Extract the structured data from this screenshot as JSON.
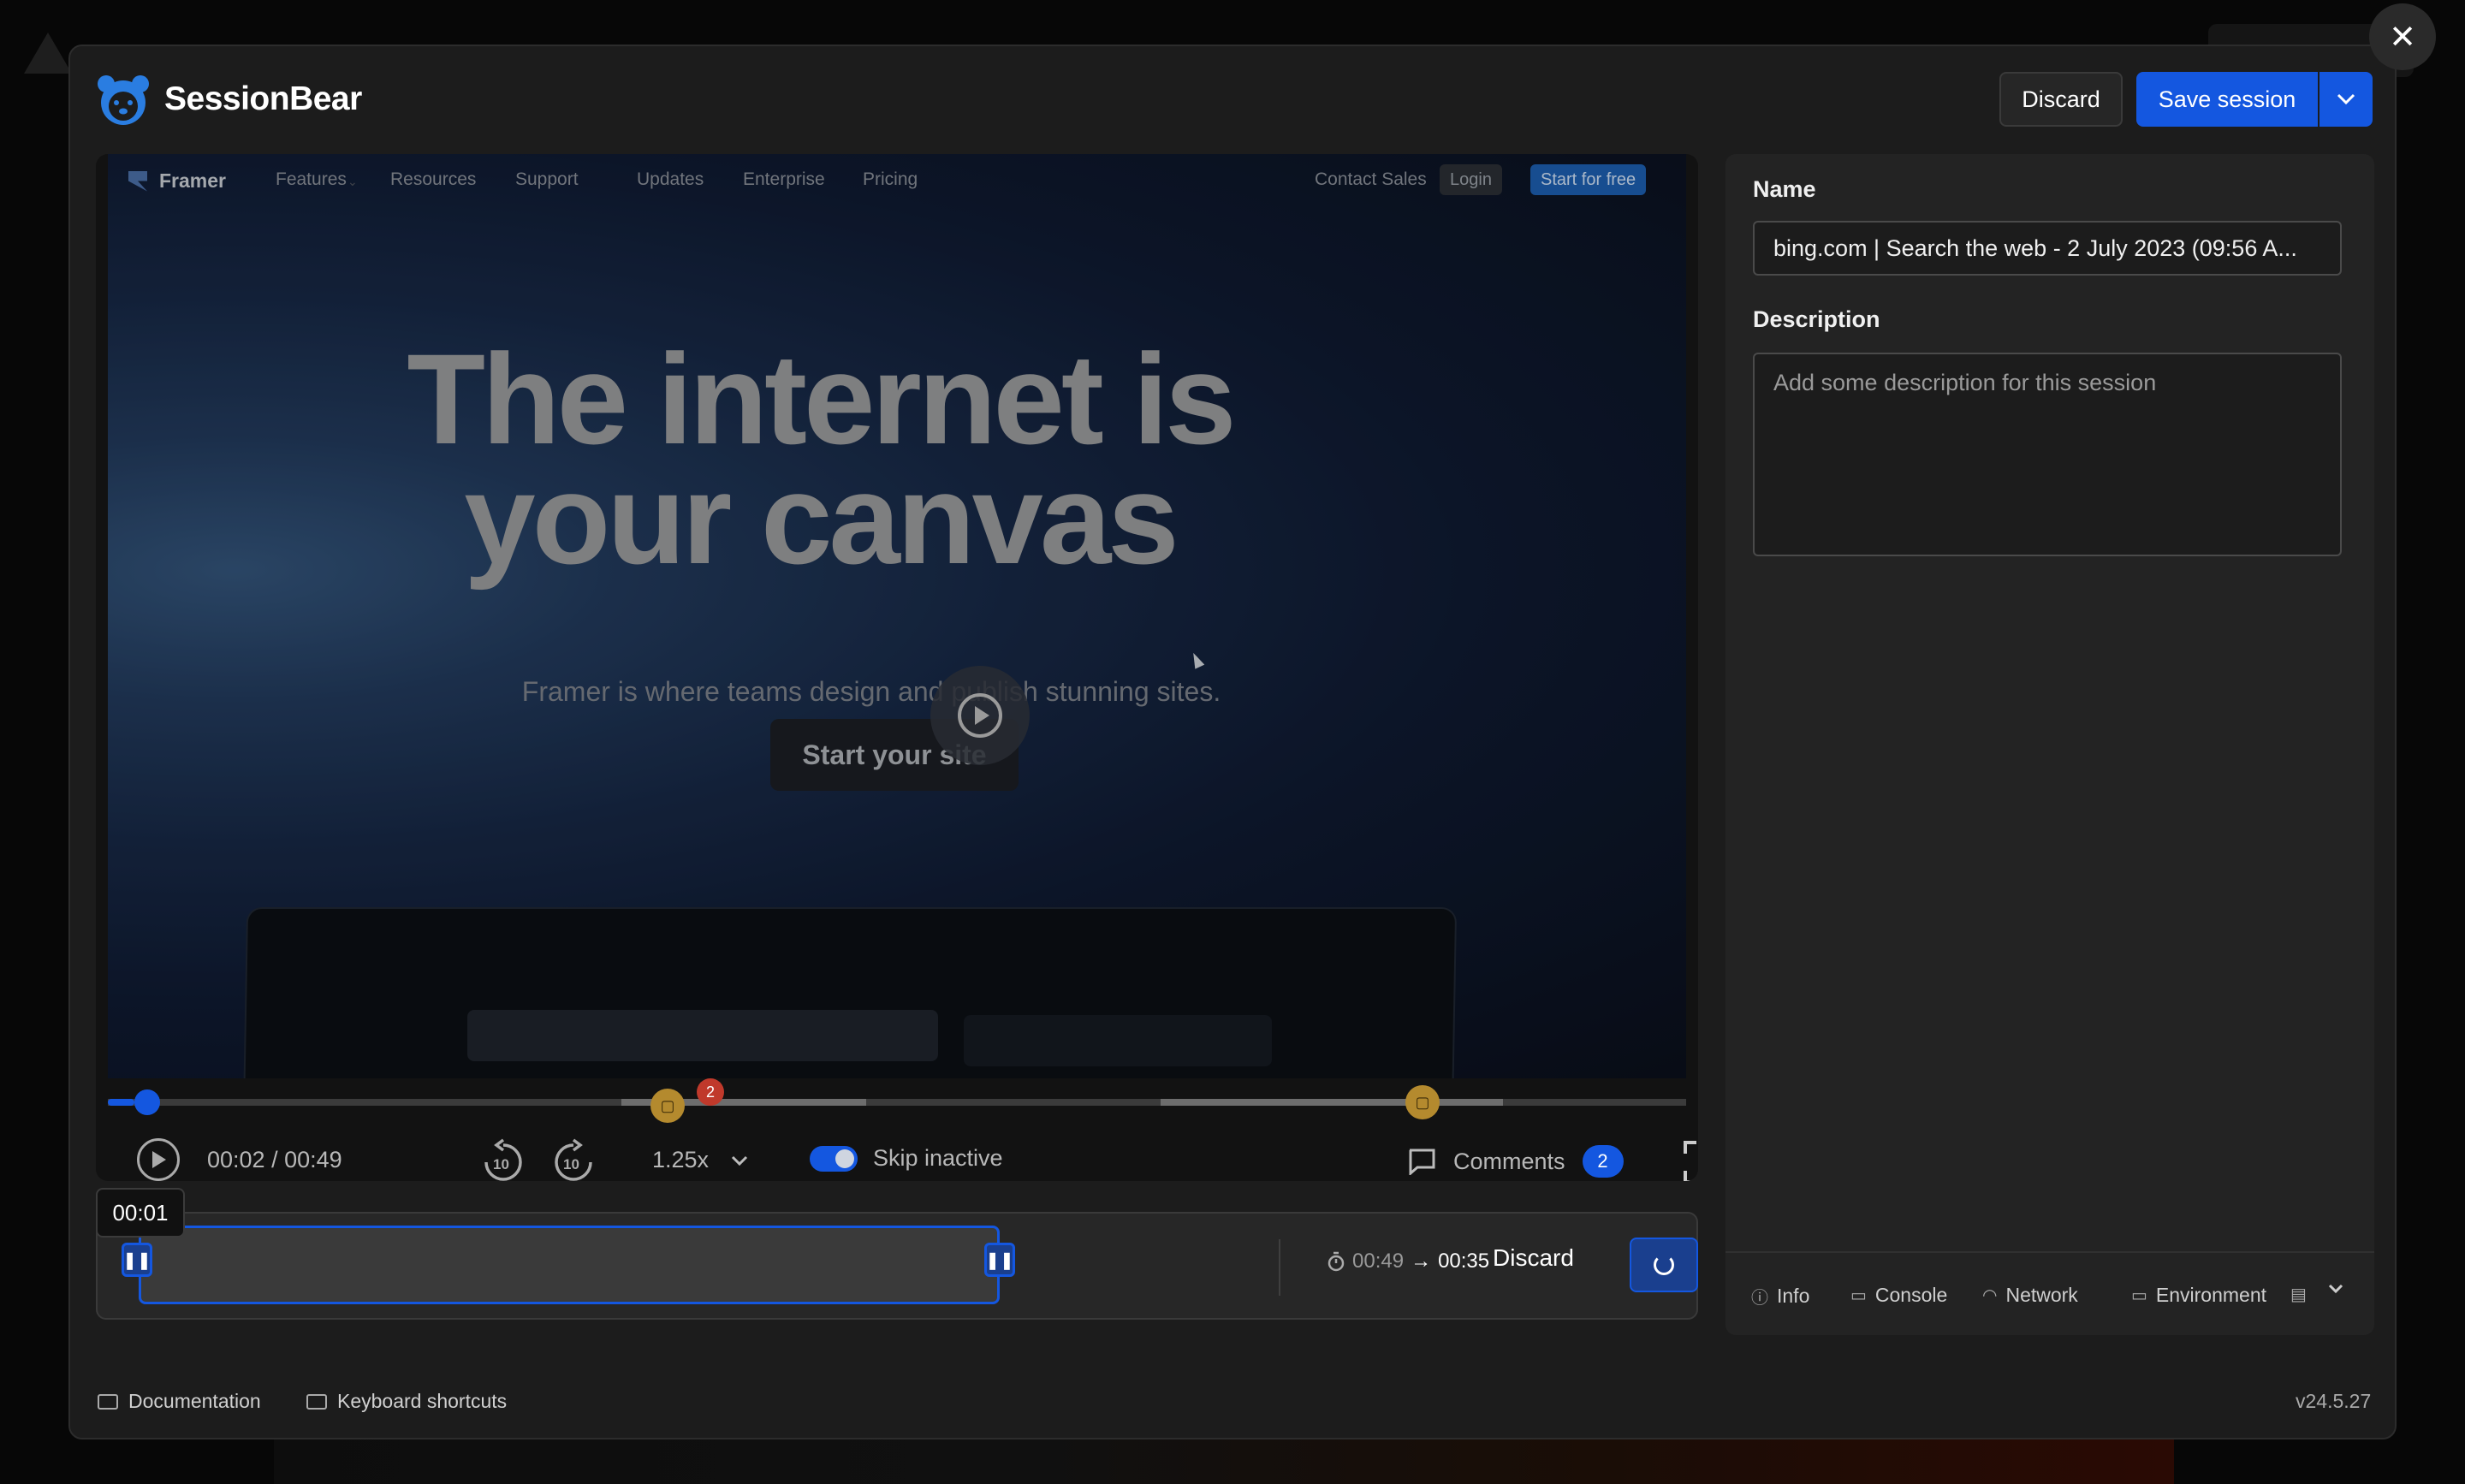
{
  "header": {
    "brand": "SessionBear",
    "discard_label": "Discard",
    "save_label": "Save session"
  },
  "recorded_site": {
    "nav_logo": "Framer",
    "nav_items": [
      "Features",
      "Resources",
      "Support",
      "Updates",
      "Enterprise",
      "Pricing"
    ],
    "contact": "Contact Sales",
    "login": "Login",
    "start_free": "Start for free",
    "hero_line1": "The internet is",
    "hero_line2": "your canvas",
    "hero_sub": "Framer is where teams design and publish stunning sites.",
    "cta": "Start your site"
  },
  "player": {
    "time": "00:02 / 00:49",
    "speed": "1.25x",
    "skip_inactive": "Skip inactive",
    "skip_inactive_on": true,
    "comments_label": "Comments",
    "comments_count": "2",
    "marker_badge": "2",
    "progress_fraction": 0.017
  },
  "trimmer": {
    "tooltip": "00:01",
    "duration_original": "00:49",
    "duration_trimmed": "00:35",
    "discard_label": "Discard"
  },
  "side_panel": {
    "name_label": "Name",
    "name_value": "bing.com | Search the web - 2 July 2023 (09:56 A...",
    "description_label": "Description",
    "description_placeholder": "Add some description for this session",
    "tabs": [
      "Info",
      "Console",
      "Network",
      "Environment"
    ]
  },
  "footer": {
    "documentation": "Documentation",
    "shortcuts": "Keyboard shortcuts",
    "version": "v24.5.27"
  },
  "colors": {
    "accent": "#1457e0",
    "modal_bg": "#1c1c1c",
    "marker": "#b48a2e",
    "badge_red": "#c0392b"
  }
}
